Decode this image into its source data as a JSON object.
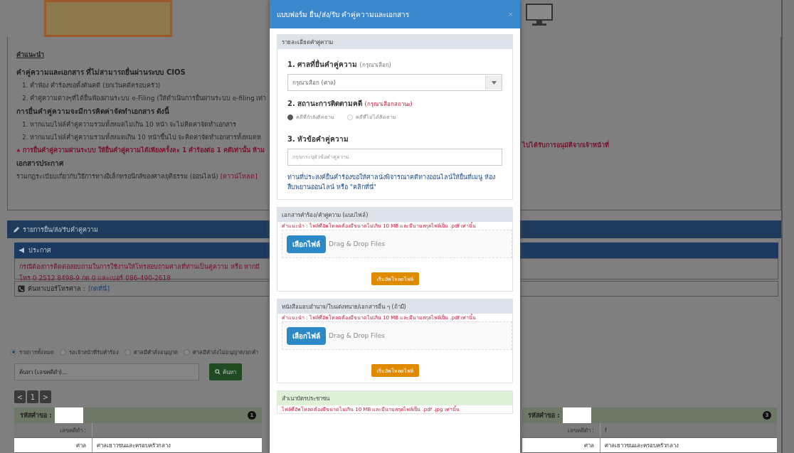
{
  "page": {
    "instructions": {
      "title": "คำแนะนำ",
      "sections": [
        {
          "heading": "คำคู่ความและเอกสาร ที่ไม่สามารถยื่นผ่านระบบ CIOS",
          "items": [
            "1. คำฟ้อง คำร้องขอตั้งต้นคดี (ยกเว้นคดีครอบครัว)",
            "2. คำคู่ความต่างๆที่ได้ยื่นฟ้องผ่านระบบ e-Filing (ให้ดำเนินการยื่นผ่านระบบ e-filing เท่า"
          ]
        },
        {
          "heading": "การยื่นคำคู่ความจะมีการคิดค่าจัดทำเอกสาร ดังนี้",
          "items": [
            "1. หากแนบไฟล์คำคู่ความรวมทั้งหมดไม่เกิน 10 หน้า จะไม่คิดค่าจัดทำเอกสาร",
            "2. หากแนบไฟล์คำคู่ความรวมทั้งหมดเกิน 10 หน้าขึ้นไป จะคิดค่าจัดทำเอกสารทั้งหมดห"
          ]
        }
      ],
      "warning_left": "การยื่นคำคู่ความผ่านระบบ ให้ยื่นคำคู่ความได้เพียงครั้งละ 1 คำร้องต่อ 1 คดีเท่านั้น ห้าม",
      "warning_right": "ไปได้รับการอนุมัติจากเจ้าหน้าที่",
      "announcement_heading": "เอกสารประกาศ",
      "announcement_text": "รวมกฎระเบียบเกี่ยวกับวิธีการทางอิเล็กทรอนิกส์ของศาลยุติธรรม (ออนไลน์)",
      "announcement_link": "[ดาวน์โหลด]"
    },
    "list_panel": {
      "title": "รายการยื่น/ส่ง/รับคำคู่ความ",
      "notice_title": "ประกาศ",
      "notice_lines": [
        "กรณีต้องการติดต่อสอบถามในการใช้งานให้โทรสอบถามศาลที่ท่านเป็นคู่ความ หรือ หากมี",
        "โทร 0 2512 8498-9 กด 0 และเบอร์ 086-490-2618"
      ],
      "phone_label": "ค้นหาเบอร์โทรศาล :",
      "phone_link": "[กดที่นี่]"
    },
    "filters": [
      {
        "label": "รายการทั้งหมด",
        "selected": true
      },
      {
        "label": "รอเจ้าหน้าที่รับคำร้อง",
        "selected": false
      },
      {
        "label": "ศาลมีคำสั่งอนุญาต",
        "selected": false
      },
      {
        "label": "ศาลมีคำสั่งไม่อนุญาต/ยกคำ",
        "selected": false
      }
    ],
    "search": {
      "placeholder": "ค้นหา (เลขคดีดำ)...",
      "button": "ค้นหา"
    },
    "pager": [
      "<",
      "1",
      ">"
    ],
    "cards": [
      {
        "title": "รหัสคำขอ :",
        "badge": "1",
        "rows": [
          {
            "label": "เลขคดีดำ :"
          },
          {
            "label": "ศาล",
            "value": "ศาลเยาวชนและครอบครัวกลาง"
          }
        ]
      },
      {
        "title": "รหัสคำขอ :",
        "badge": "3",
        "rows": [
          {
            "label": "เลขคดีดำ :",
            "value": "f"
          },
          {
            "label": "ศาล",
            "value": "ศาลเยาวชนและครอบครัวกลาง"
          }
        ]
      }
    ]
  },
  "modal": {
    "title": "แบบฟอร์ม ยื่น/ส่ง/รับ คำคู่ความและเอกสาร",
    "close": "×",
    "details": {
      "header": "รายละเอียดคำคู่ความ",
      "court_label": "1. ศาลที่ยื่นคำคู่ความ",
      "court_hint": "(กรุณาเลือก)",
      "court_value": "กรุณาเลือก (ศาล)",
      "status_label": "2. สถานะการติดตามคดี",
      "status_hint": "(กรุณาเลือกสถานะ)",
      "status_options": [
        {
          "label": "คดีที่กำลังติดตาม",
          "selected": true
        },
        {
          "label": "คดีที่ไม่ได้ติดตาม",
          "selected": false
        }
      ],
      "subject_label": "3. หัวข้อคำคู่ความ",
      "subject_placeholder": "กรุณาระบุหัวข้อคำคู่ความ",
      "online_note": "ท่านที่ประสงค์ยื่นคำร้องขอให้ศาลนั่งพิจารณาคดีทางออนไลน์ให้ยื่นที่เมนู ห้องสืบพยานออนไลน์ หรือ \"คลิกที่นี่\""
    },
    "uploads": [
      {
        "kind": "upload",
        "header": "เอกสารคำร้อง/คำคู่ความ (แนบไฟล์)",
        "note": "คำแนะนำ : ไฟล์ที่อัพโหลดต้องมีขนาดไม่เกิน 10 MB และมีนามสกุลไฟล์เป็น .pdf เท่านั้น",
        "choose": "เลือกไฟล์",
        "drop": "Drag & Drop Files",
        "start": "เริ่มอัพโหลดไฟล์"
      },
      {
        "kind": "upload",
        "header": "หนังสือมอบอำนาจ/ใบแต่งทนาย/เอกสารอื่น ๆ (ถ้ามี)",
        "note": "คำแนะนำ : ไฟล์ที่อัพโหลดต้องมีขนาดไม่เกิน 10 MB และมีนามสกุลไฟล์เป็น .pdf เท่านั้น",
        "choose": "เลือกไฟล์",
        "drop": "Drag & Drop Files",
        "start": "เริ่มอัพโหลดไฟล์"
      },
      {
        "kind": "id_copy",
        "header": "สำเนาบัตรประชาชน",
        "note": "ไฟล์ที่อัพโหลดต้องมีขนาดไม่เกิน 10 MB และมีนามสกุลไฟล์เป็น .pdf .jpg เท่านั้น"
      }
    ]
  }
}
